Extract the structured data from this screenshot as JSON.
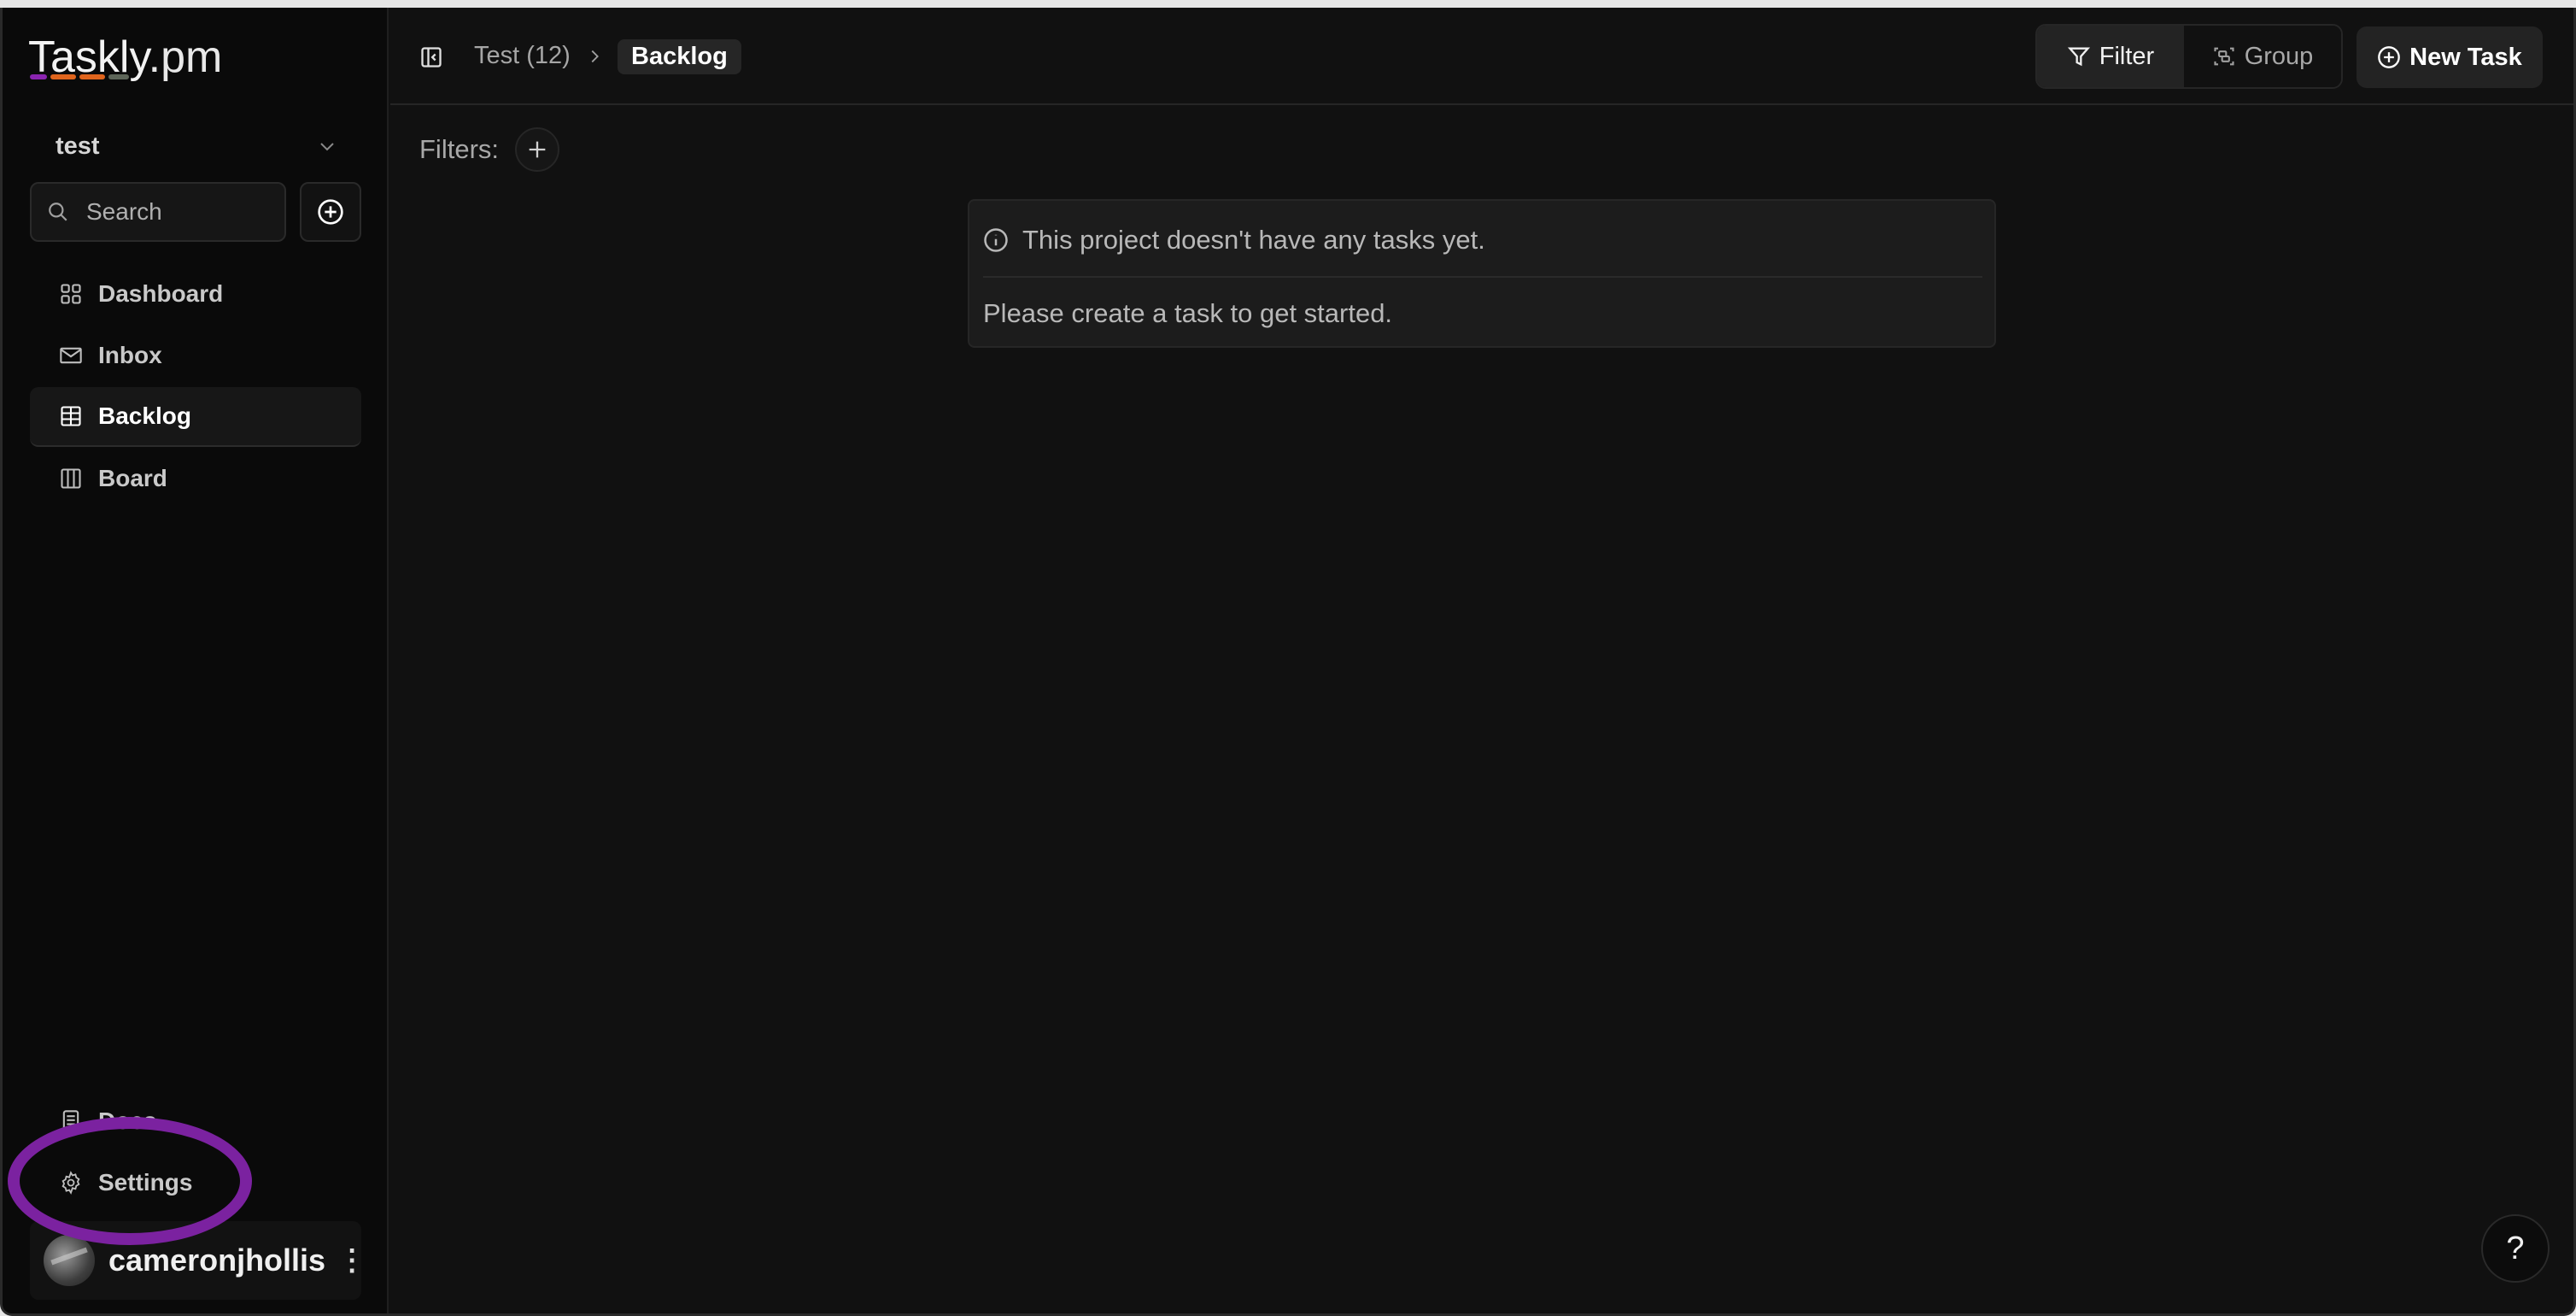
{
  "app": {
    "logo_text": "Taskly",
    "logo_suffix": ".pm",
    "logo_bar_colors": [
      "#8a24b0",
      "#e0641c",
      "#e0641c",
      "#5d6558"
    ]
  },
  "sidebar": {
    "project_name": "test",
    "search_placeholder": "Search",
    "nav_items": [
      {
        "label": "Dashboard",
        "icon": "grid-icon",
        "active": false
      },
      {
        "label": "Inbox",
        "icon": "mail-icon",
        "active": false
      },
      {
        "label": "Backlog",
        "icon": "table-icon",
        "active": true
      },
      {
        "label": "Board",
        "icon": "columns-icon",
        "active": false
      }
    ],
    "bottom_items": [
      {
        "label": "Docs",
        "icon": "document-icon"
      },
      {
        "label": "Settings",
        "icon": "gear-icon"
      }
    ],
    "user": {
      "name": "cameronjhollis"
    }
  },
  "header": {
    "breadcrumb_parent": "Test (12)",
    "breadcrumb_current": "Backlog",
    "filter_label": "Filter",
    "group_label": "Group",
    "new_task_label": "New Task"
  },
  "filters": {
    "label": "Filters:"
  },
  "empty_state": {
    "title": "This project doesn't have any tasks yet.",
    "description": "Please create a task to get started."
  },
  "help": {
    "label": "?"
  },
  "annotation": {
    "color": "#7b22a0",
    "target": "Settings"
  }
}
